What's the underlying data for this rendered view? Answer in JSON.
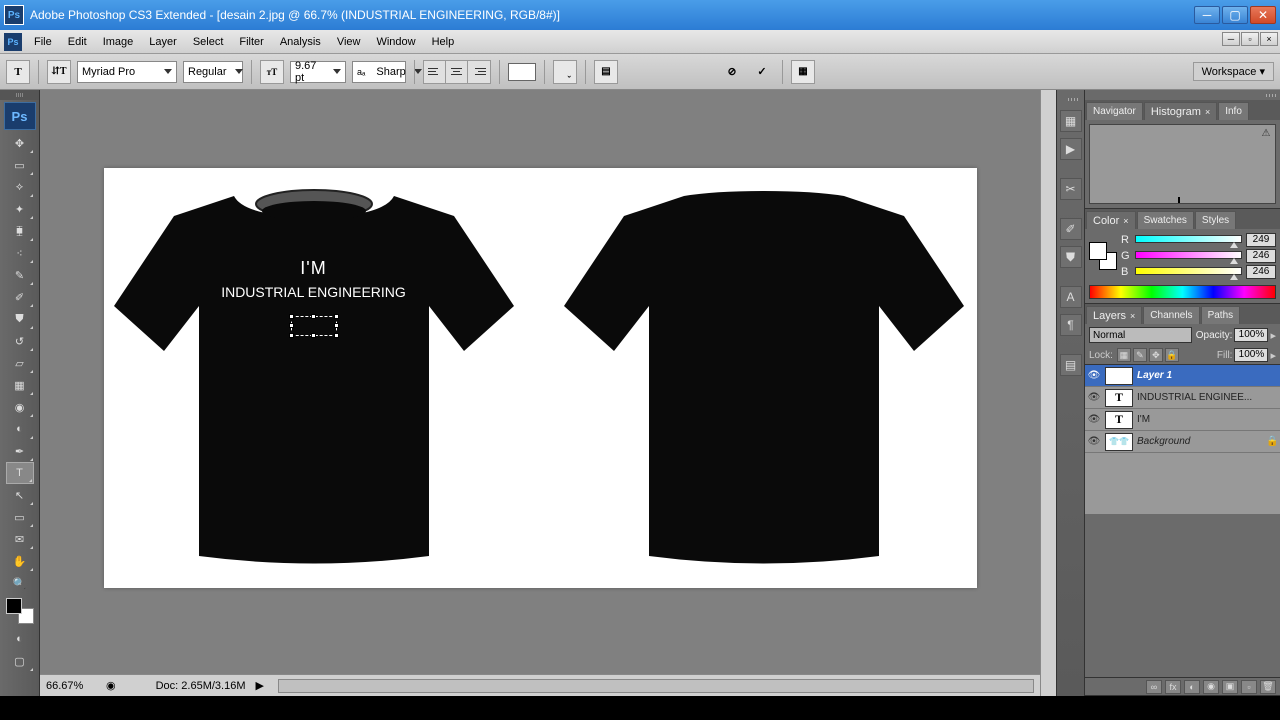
{
  "titlebar": {
    "title": "Adobe Photoshop CS3 Extended - [desain 2.jpg @ 66.7% (INDUSTRIAL ENGINEERING, RGB/8#)]"
  },
  "menu": [
    "File",
    "Edit",
    "Image",
    "Layer",
    "Select",
    "Filter",
    "Analysis",
    "View",
    "Window",
    "Help"
  ],
  "options": {
    "font": "Myriad Pro",
    "weight": "Regular",
    "size": "9.67 pt",
    "aa": "Sharp",
    "workspace": "Workspace ▾"
  },
  "status": {
    "zoom": "66.67%",
    "doc": "Doc: 2.65M/3.16M"
  },
  "panels": {
    "nav_tabs": [
      "Navigator",
      "Histogram",
      "Info"
    ],
    "color_tabs": [
      "Color",
      "Swatches",
      "Styles"
    ],
    "rgb": {
      "r": "249",
      "g": "246",
      "b": "246"
    },
    "layer_tabs": [
      "Layers",
      "Channels",
      "Paths"
    ],
    "blend": "Normal",
    "opacity_label": "Opacity:",
    "opacity": "100%",
    "fill_label": "Fill:",
    "fill": "100%",
    "lock_label": "Lock:"
  },
  "layers": [
    {
      "name": "Layer 1",
      "type": "T",
      "selected": true
    },
    {
      "name": "INDUSTRIAL ENGINEE...",
      "type": "T",
      "selected": false
    },
    {
      "name": "I'M",
      "type": "T",
      "selected": false
    },
    {
      "name": "Background",
      "type": "bg",
      "selected": false,
      "locked": true
    }
  ],
  "shirt": {
    "line1": "I'M",
    "line2": "INDUSTRIAL ENGINEERING"
  }
}
